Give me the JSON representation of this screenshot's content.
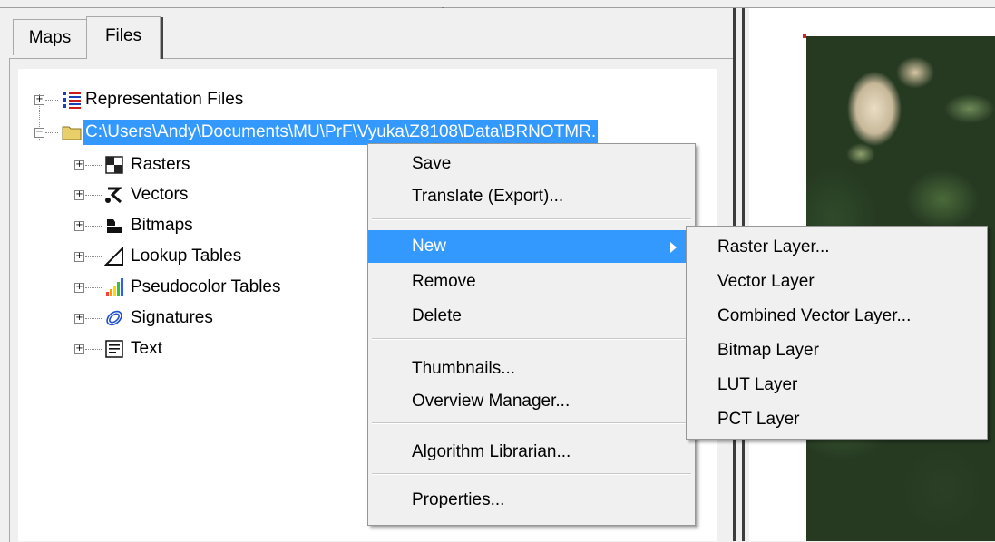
{
  "tabs": [
    {
      "label": "Maps",
      "active": false
    },
    {
      "label": "Files",
      "active": true
    }
  ],
  "tree": {
    "items": [
      {
        "label": "Representation Files",
        "icon": "representation-files-icon",
        "level": 0,
        "expander": "+"
      },
      {
        "label": "C:\\Users\\Andy\\Documents\\MU\\PrF\\Vyuka\\Z8108\\Data\\BRNOTMR.",
        "icon": "folder-icon",
        "level": 0,
        "expander": "-",
        "selected": true
      },
      {
        "label": "Rasters",
        "icon": "raster-icon",
        "level": 1,
        "expander": "+"
      },
      {
        "label": "Vectors",
        "icon": "vector-icon",
        "level": 1,
        "expander": "+"
      },
      {
        "label": "Bitmaps",
        "icon": "bitmap-icon",
        "level": 1,
        "expander": "+"
      },
      {
        "label": "Lookup Tables",
        "icon": "lookup-table-icon",
        "level": 1,
        "expander": "+"
      },
      {
        "label": "Pseudocolor Tables",
        "icon": "pseudocolor-table-icon",
        "level": 1,
        "expander": "+"
      },
      {
        "label": "Signatures",
        "icon": "signature-icon",
        "level": 1,
        "expander": "+"
      },
      {
        "label": "Text",
        "icon": "text-icon",
        "level": 1,
        "expander": "+"
      }
    ]
  },
  "context_menu": {
    "groups": [
      [
        "Save",
        "Translate (Export)..."
      ],
      [
        "New",
        "Remove",
        "Delete"
      ],
      [
        "Thumbnails...",
        "Overview Manager..."
      ],
      [
        "Algorithm Librarian..."
      ],
      [
        "Properties..."
      ]
    ],
    "highlighted": "New"
  },
  "submenu": {
    "items": [
      "Raster Layer...",
      "Vector Layer",
      "Combined Vector Layer...",
      "Bitmap Layer",
      "LUT Layer",
      "PCT Layer"
    ]
  },
  "colors": {
    "selection": "#3399ff",
    "menu_bg": "#f0f0f0",
    "panel_bg": "#ffffff"
  }
}
